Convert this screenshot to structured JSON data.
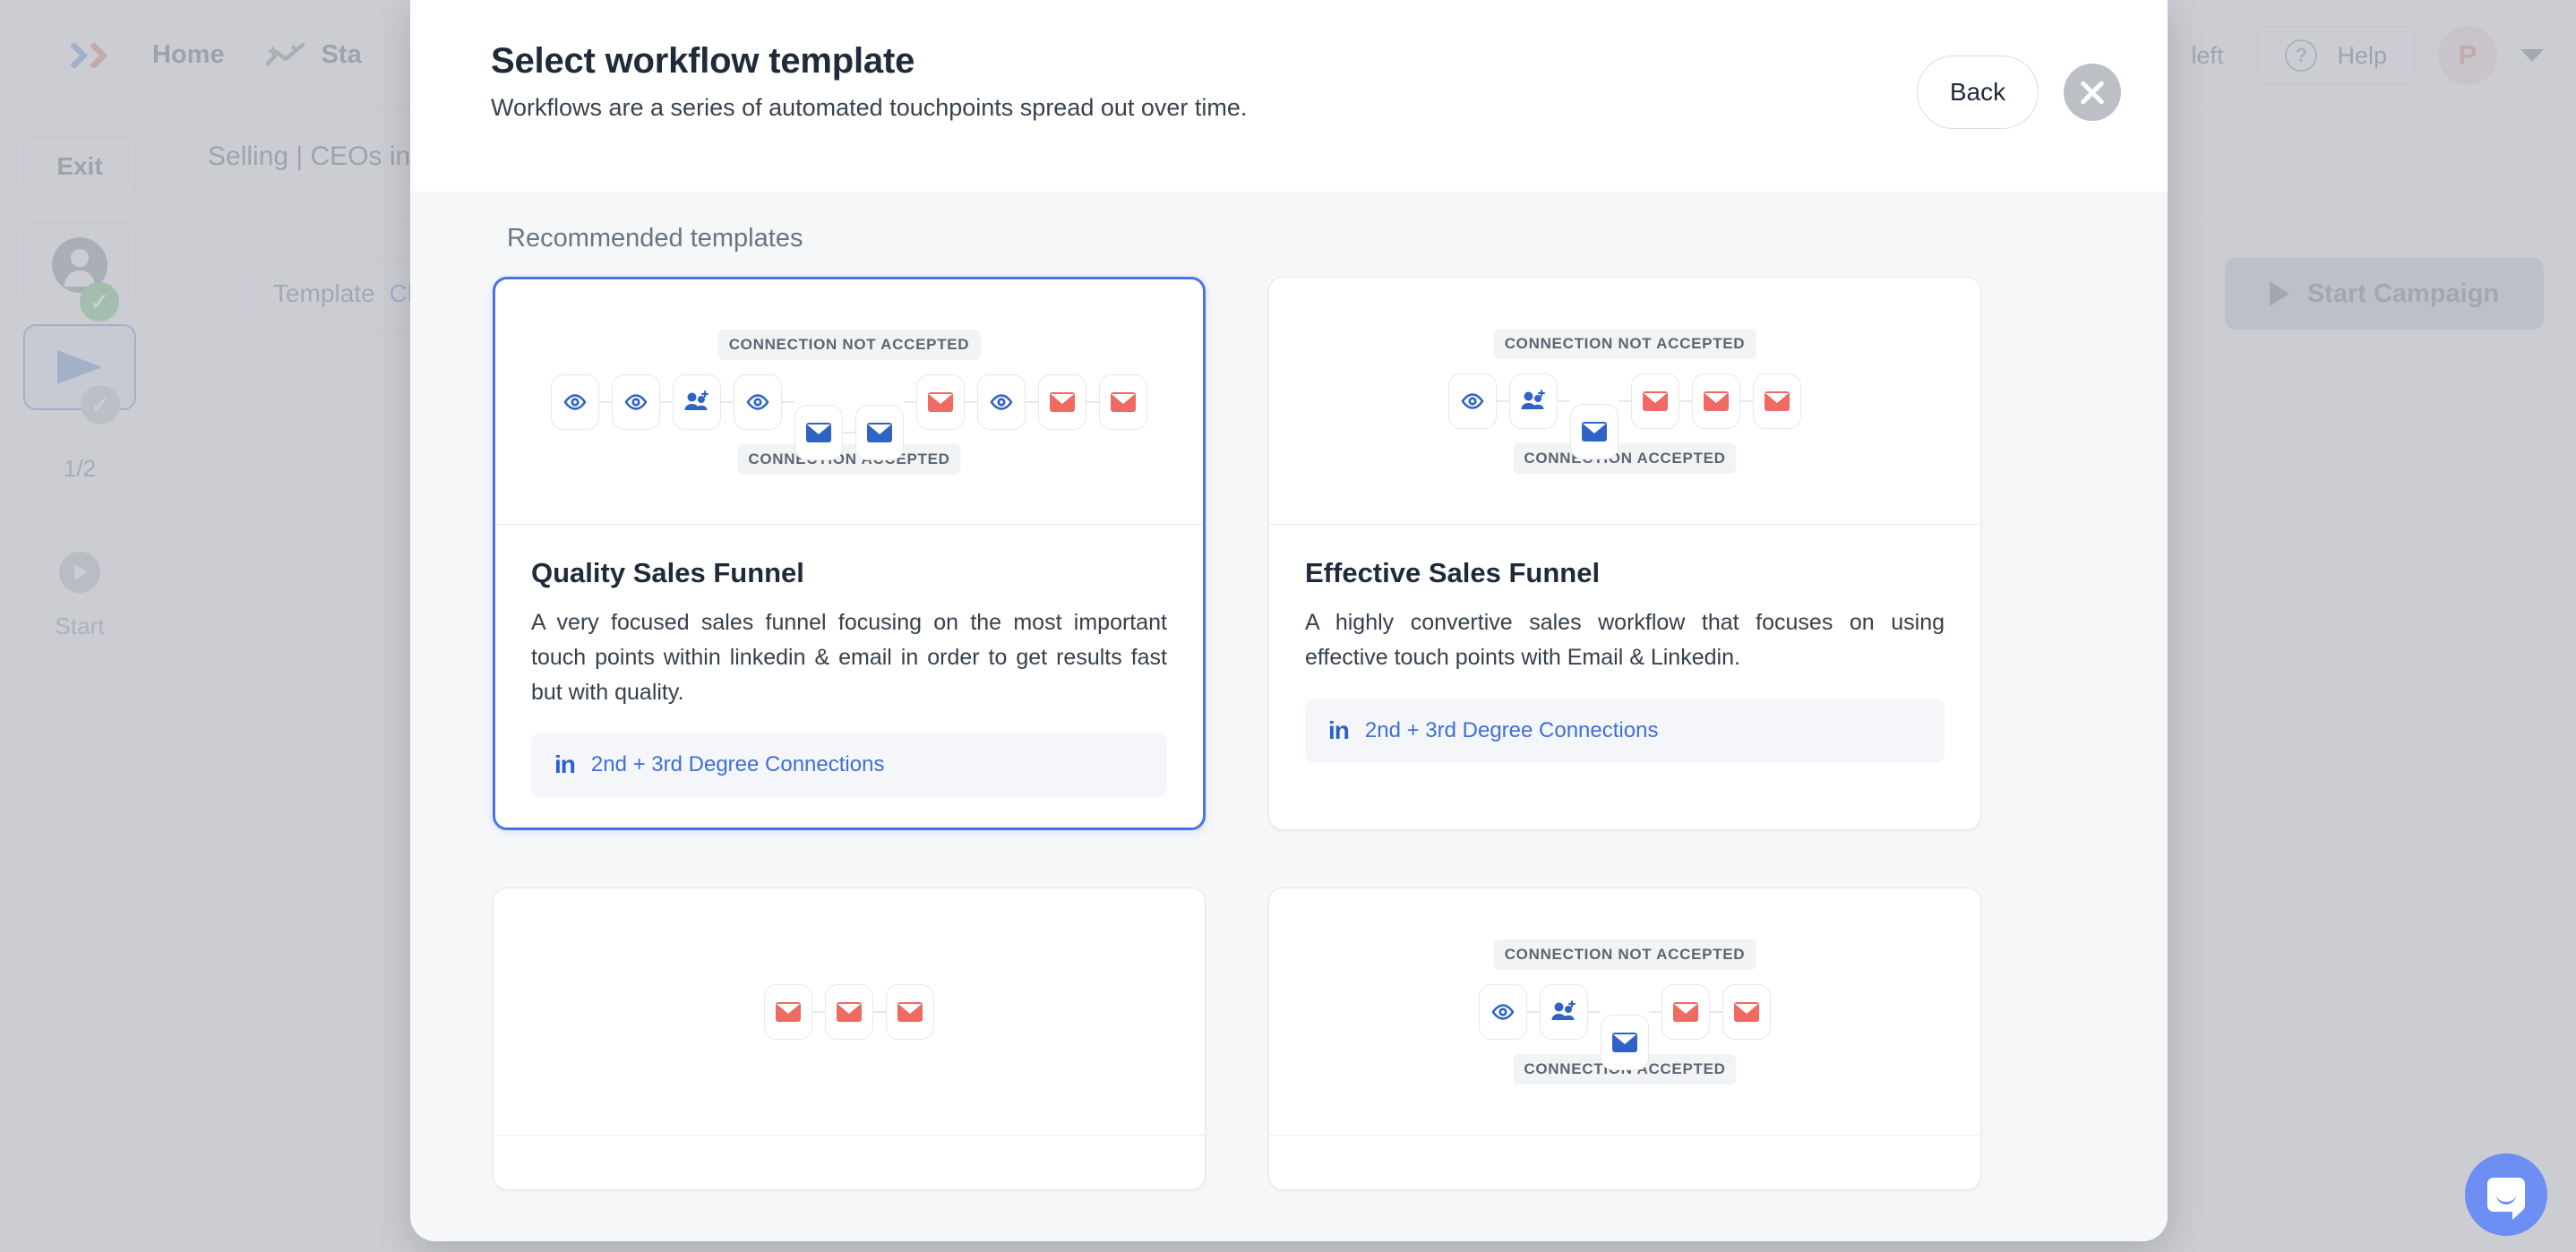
{
  "background": {
    "nav": {
      "logo_name": "brand-logo",
      "home_label": "Home",
      "stats_label": "Sta",
      "credits_label": "left",
      "help_label": "Help",
      "avatar_initial": "P"
    },
    "sidebar": {
      "exit_label": "Exit",
      "step_count": "1/2",
      "start_label": "Start"
    },
    "campaign": {
      "title": "Selling | CEOs in",
      "template_label": "Template",
      "template_value": "Ch",
      "start_campaign_label": "Start Campaign"
    }
  },
  "modal": {
    "title": "Select workflow template",
    "subtitle": "Workflows are a series of automated touchpoints spread out over time.",
    "back_label": "Back",
    "close_label": "Close",
    "section_label": "Recommended templates",
    "labels": {
      "connection_not_accepted": "CONNECTION NOT ACCEPTED",
      "connection_accepted": "CONNECTION ACCEPTED"
    },
    "colors": {
      "accent_blue": "#4a72e8",
      "icon_blue": "#2f63c4",
      "icon_red": "#ee6a63",
      "linkedin_blue": "#3f6fd8",
      "modal_bg": "#f6f7f9",
      "card_bg": "#ffffff"
    },
    "templates": [
      {
        "id": "quality-sales-funnel",
        "name": "Quality Sales Funnel",
        "description": "A very focused sales funnel focusing on the most important touch points within linkedin & email in order to get results fast but with quality.",
        "audience_label": "2nd + 3rd Degree Connections",
        "selected": true,
        "has_branch": true,
        "main_nodes": [
          "eye",
          "eye",
          "connect",
          "eye",
          "gap",
          "email-red",
          "eye",
          "email-red",
          "email-red"
        ],
        "branch_nodes": [
          "email-blue",
          "email-blue"
        ]
      },
      {
        "id": "effective-sales-funnel",
        "name": "Effective Sales Funnel",
        "description": "A highly convertive sales workflow that focuses on using effective touch points with Email & Linkedin.",
        "audience_label": "2nd + 3rd Degree Connections",
        "selected": false,
        "has_branch": true,
        "main_nodes": [
          "eye",
          "connect",
          "gap",
          "email-red",
          "email-red",
          "email-red"
        ],
        "branch_nodes": [
          "email-blue"
        ]
      },
      {
        "id": "email-only-funnel",
        "name": "",
        "description": "",
        "audience_label": "",
        "selected": false,
        "has_branch": false,
        "main_nodes": [
          "email-red",
          "email-red",
          "email-red"
        ],
        "branch_nodes": []
      },
      {
        "id": "linkedin-email-funnel",
        "name": "",
        "description": "",
        "audience_label": "",
        "selected": false,
        "has_branch": true,
        "main_nodes": [
          "eye",
          "connect",
          "gap",
          "email-red",
          "email-red"
        ],
        "branch_nodes": [
          "email-blue"
        ]
      }
    ]
  },
  "intercom": {
    "name": "intercom-chat-launcher"
  }
}
